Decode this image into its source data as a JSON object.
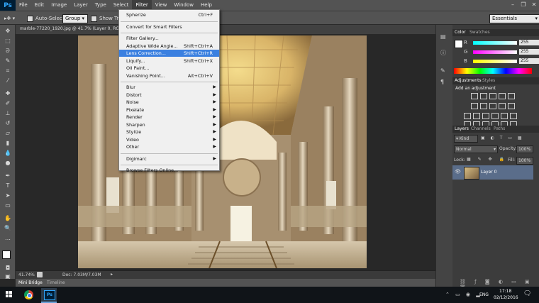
{
  "menubar": {
    "logo": "Ps",
    "items": [
      "File",
      "Edit",
      "Image",
      "Layer",
      "Type",
      "Select",
      "Filter",
      "View",
      "Window",
      "Help"
    ],
    "active": "Filter"
  },
  "options": {
    "auto_select": "Auto-Select:",
    "group": "Group",
    "show_transform": "Show Trans",
    "workspace": "Essentials"
  },
  "document": {
    "tab_title": "marble-77220_1920.jpg @ 41.7% (Layer 0, RGB/8",
    "zoom": "41.74%",
    "doc_info": "Doc: 7.03M/7.03M"
  },
  "bottom_tabs": [
    "Mini Bridge",
    "Timeline"
  ],
  "filter_menu": {
    "items": [
      {
        "label": "Spherize",
        "shortcut": "Ctrl+F"
      },
      {
        "sep": true
      },
      {
        "label": "Convert for Smart Filters"
      },
      {
        "sep": true
      },
      {
        "label": "Filter Gallery..."
      },
      {
        "label": "Adaptive Wide Angle...",
        "shortcut": "Shift+Ctrl+A"
      },
      {
        "label": "Lens Correction...",
        "shortcut": "Shift+Ctrl+R",
        "highlight": true
      },
      {
        "label": "Liquify...",
        "shortcut": "Shift+Ctrl+X"
      },
      {
        "label": "Oil Paint..."
      },
      {
        "label": "Vanishing Point...",
        "shortcut": "Alt+Ctrl+V"
      },
      {
        "sep": true
      },
      {
        "label": "Blur",
        "submenu": true
      },
      {
        "label": "Distort",
        "submenu": true
      },
      {
        "label": "Noise",
        "submenu": true
      },
      {
        "label": "Pixelate",
        "submenu": true
      },
      {
        "label": "Render",
        "submenu": true
      },
      {
        "label": "Sharpen",
        "submenu": true
      },
      {
        "label": "Stylize",
        "submenu": true
      },
      {
        "label": "Video",
        "submenu": true
      },
      {
        "label": "Other",
        "submenu": true
      },
      {
        "sep": true
      },
      {
        "label": "Digimarc",
        "submenu": true
      },
      {
        "sep": true
      },
      {
        "label": "Browse Filters Online..."
      }
    ]
  },
  "color_panel": {
    "tabs": [
      "Color",
      "Swatches"
    ],
    "channels": [
      {
        "name": "R",
        "value": "255"
      },
      {
        "name": "G",
        "value": "255"
      },
      {
        "name": "B",
        "value": "255"
      }
    ]
  },
  "adjustments_panel": {
    "tabs": [
      "Adjustments",
      "Styles"
    ],
    "heading": "Add an adjustment"
  },
  "layers_panel": {
    "tabs": [
      "Layers",
      "Channels",
      "Paths"
    ],
    "kind": "Kind",
    "blend_mode": "Normal",
    "opacity_label": "Opacity:",
    "opacity": "100%",
    "lock_label": "Lock:",
    "fill_label": "Fill:",
    "fill": "100%",
    "layer_name": "Layer 0"
  },
  "taskbar": {
    "lang": "ENG",
    "time": "17:18",
    "date": "02/12/2016",
    "ps_label": "Ps"
  },
  "colors": {
    "highlight": "#3b80e0",
    "ps_blue": "#31a8ff"
  }
}
